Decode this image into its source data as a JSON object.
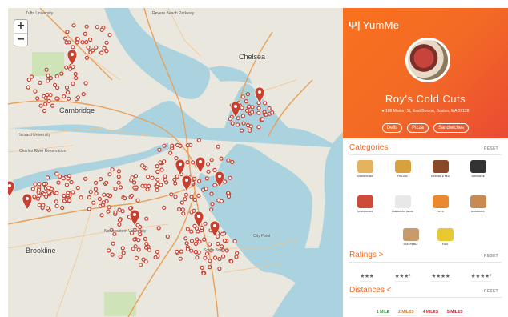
{
  "map": {
    "zoom_in": "+",
    "zoom_out": "−",
    "labels": {
      "chelsea": "Chelsea",
      "cambridge": "Cambridge",
      "brookline": "Brookline",
      "tufts": "Tufts University",
      "harvard": "Harvard University",
      "northeastern": "Northeastern University",
      "south_boston": "South Boston",
      "city_point": "City Point",
      "revere_beach": "Revere Beach Parkway",
      "charles_river": "Charles River Reservation"
    }
  },
  "app": {
    "name": "YumMe",
    "logo_icon": "fork-knife-icon"
  },
  "restaurant": {
    "name": "Roy's Cold Cuts",
    "address": "186 Marion St, East Boston, Boston, MA 02128",
    "tags": [
      "Delis",
      "Pizza",
      "Sandwiches"
    ]
  },
  "categories": {
    "title": "Categories",
    "reset": "RESET",
    "items": [
      {
        "label": "SANDWICHES",
        "color": "#e7b25c"
      },
      {
        "label": "ITALIAN",
        "color": "#d7a13e"
      },
      {
        "label": "COFFEE & TEA",
        "color": "#8a4a2a"
      },
      {
        "label": "JAPANESE",
        "color": "#333333"
      },
      {
        "label": "SUSHI BARS",
        "color": "#d04a3a"
      },
      {
        "label": "AMERICAN (NEW)",
        "color": "#e8e8e8"
      },
      {
        "label": "PIZZA",
        "color": "#e88a30"
      },
      {
        "label": "BAKERIES",
        "color": "#c88a50"
      },
      {
        "label": "CAFETERIA",
        "color": "#c99a6a"
      },
      {
        "label": "THAI",
        "color": "#e9c832"
      }
    ]
  },
  "ratings": {
    "title": "Ratings >",
    "reset": "RESET",
    "options": [
      "★★★",
      "★★★¹",
      "★★★★",
      "★★★★¹"
    ]
  },
  "distances": {
    "title": "Distances <",
    "reset": "RESET",
    "options": [
      {
        "label": "1 MILE",
        "color": "#2a9d2a"
      },
      {
        "label": "2 MILES",
        "color": "#e8761e"
      },
      {
        "label": "4 MILES",
        "color": "#d92b2b"
      },
      {
        "label": "5 MILES",
        "color": "#c4142a"
      }
    ]
  },
  "colors": {
    "accent": "#f36a25",
    "water": "#aad3df",
    "pin": "#c9402f"
  }
}
